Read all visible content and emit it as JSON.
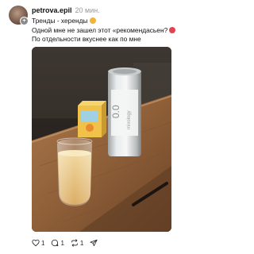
{
  "post": {
    "username": "petrova.epil",
    "time": "20 мин.",
    "lines": [
      "Тренды - херенды",
      "Одной мне не зашел этот «рекомендасьен?",
      "По отдельности вкуснее как по мне"
    ],
    "actions": {
      "likes": "1",
      "comments": "1",
      "reposts": "1"
    }
  },
  "icons": {
    "avatar_badge": "plus-icon",
    "emoji_line1": "smiling-face-emoji",
    "emoji_line2": "grimace-face-emoji",
    "like": "heart-icon",
    "comment": "comment-icon",
    "repost": "repost-icon",
    "share": "send-icon"
  },
  "colors": {
    "username": "#111111",
    "time": "#9a9a9a",
    "text": "#111111"
  }
}
